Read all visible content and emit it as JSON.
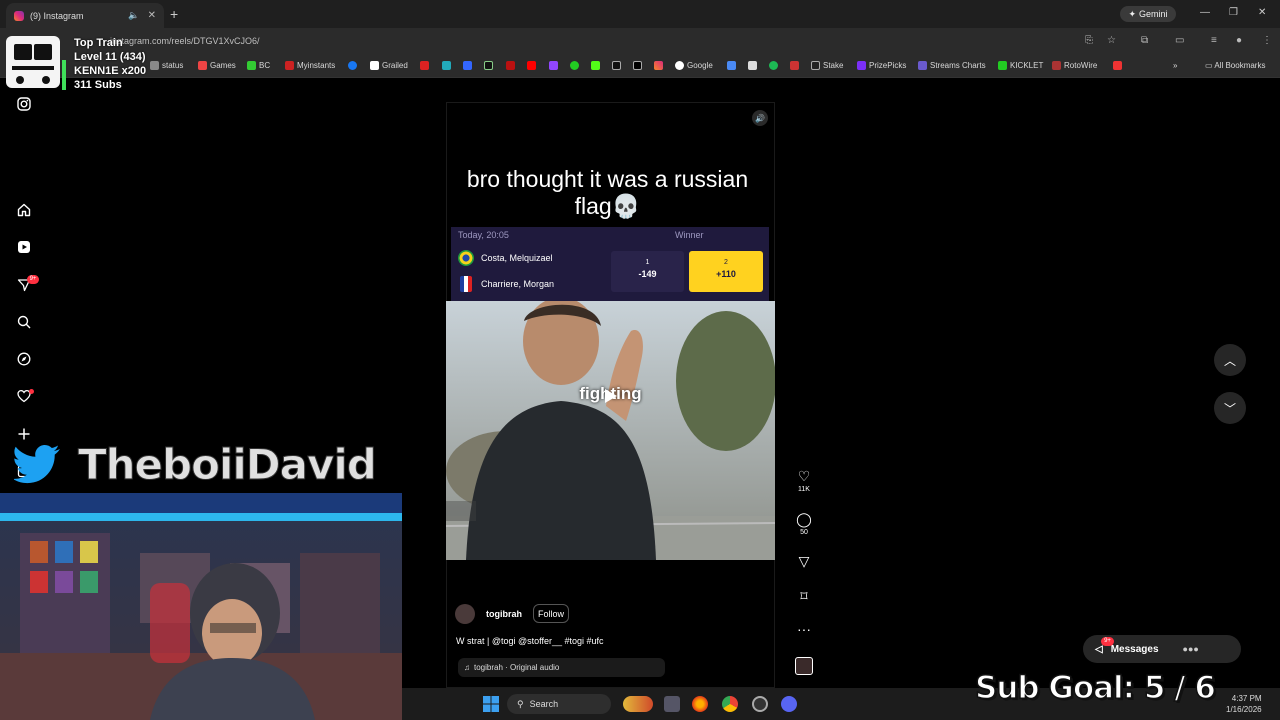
{
  "browser": {
    "tab_title": "(9) Instagram",
    "url": "instagram.com/reels/DTGV1XvCJO6/",
    "gemini_label": "Gemini",
    "bookmarks": [
      "status",
      "Games",
      "BC",
      "Myinstants",
      "Grailed",
      "Google",
      "Stake",
      "PrizePicks",
      "Streams Charts",
      "KICKLET",
      "RotoWire"
    ],
    "all_bookmarks_label": "All Bookmarks"
  },
  "overlay": {
    "train_title": "Top Train",
    "train_level": "Level 11  (434)",
    "train_user": "KENN1E x200",
    "train_subs": "311 Subs",
    "twitter_handle": "TheboiiDavid",
    "sub_goal": "Sub Goal:  5 / 6"
  },
  "sidebar": {
    "notification_badge": "9+"
  },
  "reel": {
    "caption": "bro thought it was a russian flag💀",
    "odds": {
      "date": "Today, 20:05",
      "market": "Winner",
      "fighter1": "Costa, Melquizael",
      "fighter2": "Charriere, Morgan",
      "option1_num": "1",
      "option1_odds": "-149",
      "option2_num": "2",
      "option2_odds": "+110"
    },
    "video_text": "fighting",
    "author": "togibrah",
    "follow_label": "Follow",
    "description": "W strat | @togi @stoffer__ #togi #ufc",
    "audio": "togibrah · Original audio",
    "likes": "11K",
    "comments": "50"
  },
  "messages": {
    "label": "Messages",
    "badge": "9+"
  },
  "taskbar": {
    "search_placeholder": "Search",
    "time": "4:37 PM",
    "date": "1/16/2026"
  }
}
